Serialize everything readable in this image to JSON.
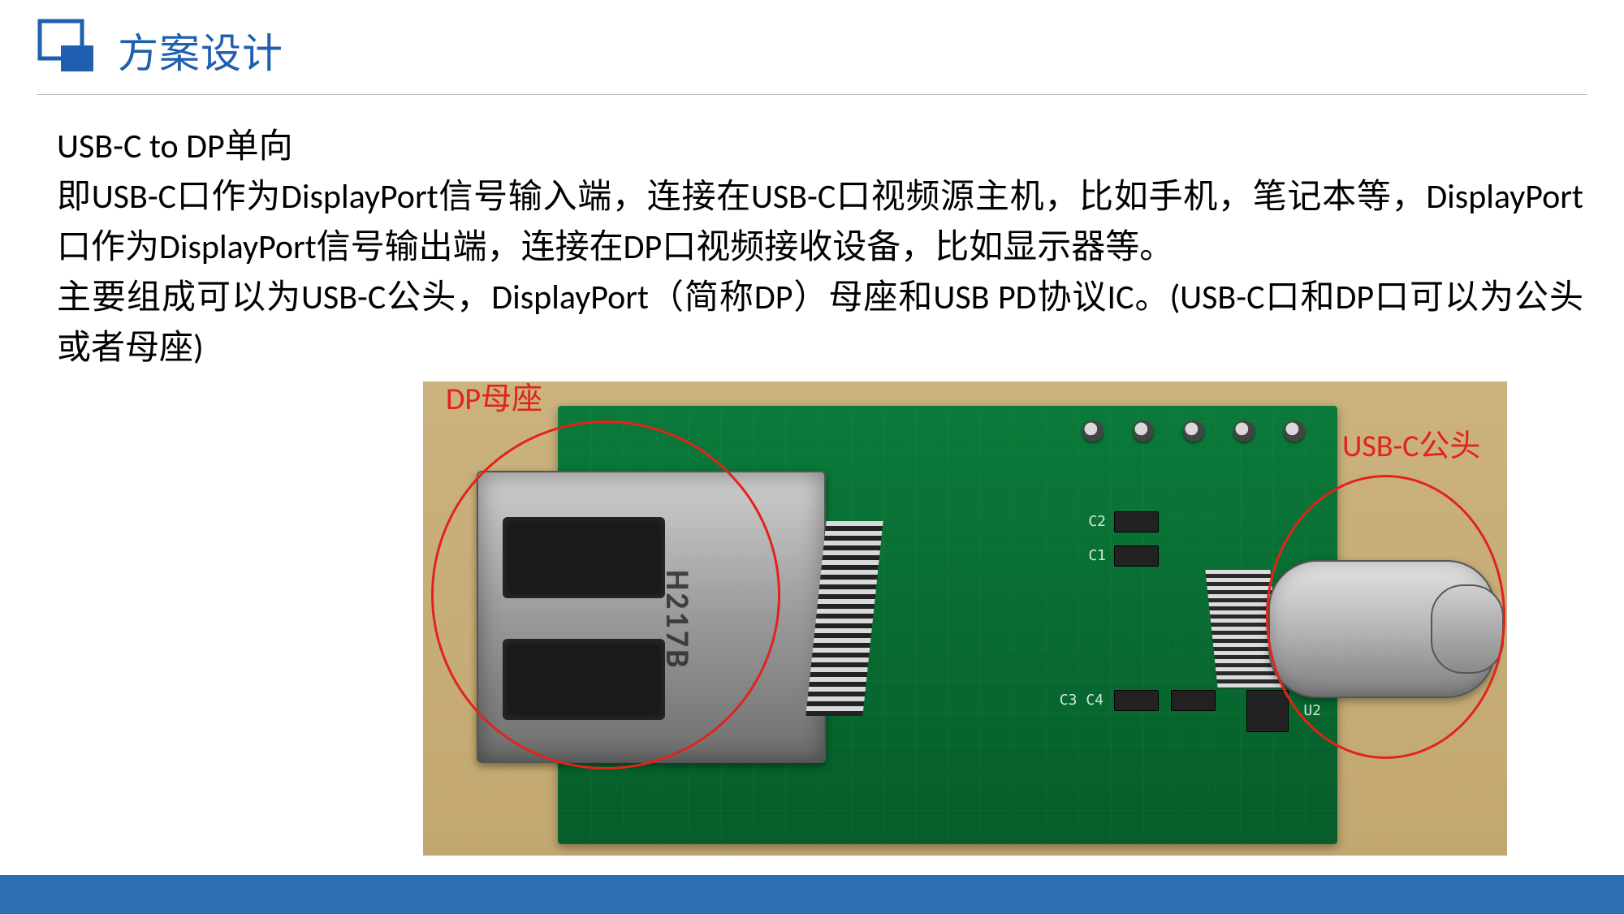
{
  "header": {
    "title": "方案设计",
    "accent_color": "#1F5FB0"
  },
  "body": {
    "line1": "USB-C to DP单向",
    "para1": "即USB-C口作为DisplayPort信号输入端，连接在USB-C口视频源主机，比如手机，笔记本等，DisplayPort口作为DisplayPort信号输出端，连接在DP口视频接收设备，比如显示器等。",
    "para2": " 主要组成可以为USB-C公头，DisplayPort（简称DP）母座和USB PD协议IC。(USB-C口和DP口可以为公头或者母座)"
  },
  "photo": {
    "label_dp": "DP母座",
    "label_usbc": "USB-C公头",
    "dp_stamp": "H217B",
    "silk": {
      "c1": "C1",
      "c2": "C2",
      "c3": "C3",
      "c4": "C4",
      "u2": "U2"
    }
  },
  "colors": {
    "annotation_red": "#E2231A",
    "bottom_bar": "#2E6DB4"
  }
}
